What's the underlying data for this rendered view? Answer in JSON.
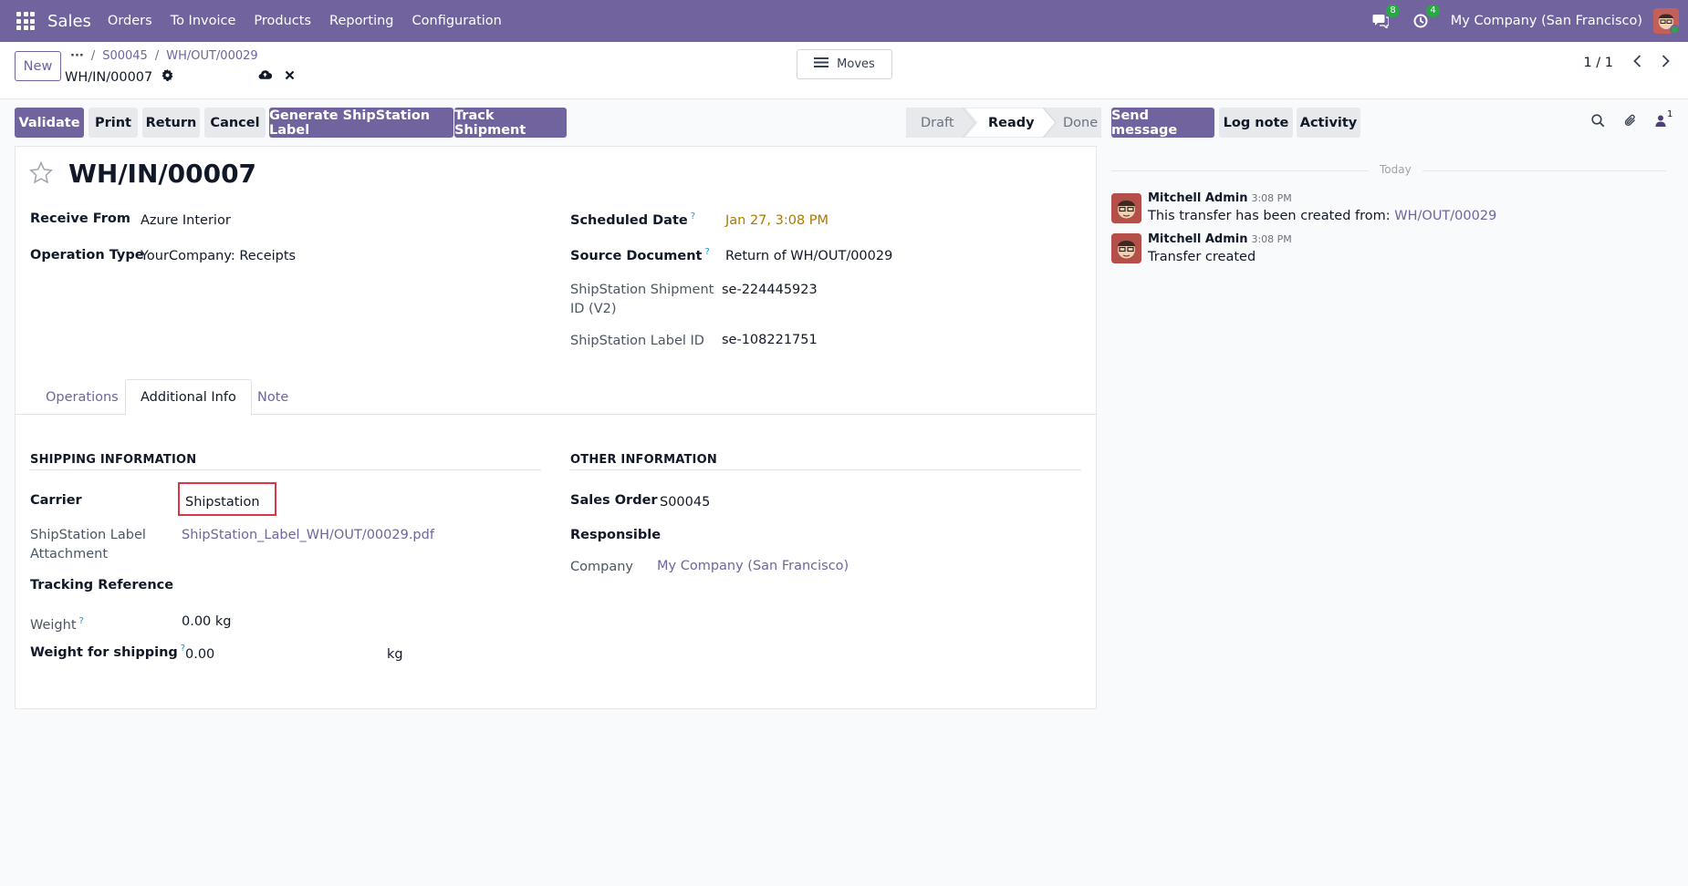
{
  "nav": {
    "app_name": "Sales",
    "menu": [
      "Orders",
      "To Invoice",
      "Products",
      "Reporting",
      "Configuration"
    ],
    "messages_count": "8",
    "activities_count": "4",
    "company": "My Company (San Francisco)"
  },
  "control": {
    "new_label": "New",
    "breadcrumbs": [
      "S00045",
      "WH/OUT/00029"
    ],
    "record_name": "WH/IN/00007",
    "moves_label": "Moves",
    "pager": "1 / 1"
  },
  "actions": {
    "validate": "Validate",
    "print": "Print",
    "return": "Return",
    "cancel": "Cancel",
    "generate_label": "Generate ShipStation Label",
    "track": "Track Shipment"
  },
  "status": {
    "draft": "Draft",
    "ready": "Ready",
    "done": "Done",
    "current": "Ready"
  },
  "form": {
    "title": "WH/IN/00007",
    "receive_from_label": "Receive From",
    "receive_from": "Azure Interior",
    "operation_type_label": "Operation Type",
    "operation_type": "YourCompany: Receipts",
    "scheduled_date_label": "Scheduled Date",
    "scheduled_date": "Jan 27, 3:08 PM",
    "source_document_label": "Source Document",
    "source_document": "Return of WH/OUT/00029",
    "shipment_id_label_1": "ShipStation Shipment",
    "shipment_id_label_2": "ID (V2)",
    "shipment_id": "se-224445923",
    "label_id_label": "ShipStation Label ID",
    "label_id": "se-108221751",
    "help_mark": "?"
  },
  "tabs": [
    "Operations",
    "Additional Info",
    "Note"
  ],
  "shipping": {
    "title": "SHIPPING INFORMATION",
    "carrier_label": "Carrier",
    "carrier": "Shipstation",
    "attachment_label_1": "ShipStation Label",
    "attachment_label_2": "Attachment",
    "attachment": "ShipStation_Label_WH/OUT/00029.pdf",
    "tracking_label": "Tracking Reference",
    "weight_label": "Weight",
    "weight": "0.00",
    "weight_unit": "kg",
    "weight_ship_label": "Weight for shipping",
    "weight_ship": "0.00",
    "weight_ship_unit": "kg"
  },
  "other": {
    "title": "OTHER INFORMATION",
    "sales_order_label": "Sales Order",
    "sales_order": "S00045",
    "responsible_label": "Responsible",
    "company_label": "Company",
    "company": "My Company (San Francisco)"
  },
  "chatter": {
    "send_message": "Send message",
    "log_note": "Log note",
    "activity": "Activity",
    "followers_count": "1",
    "today": "Today",
    "messages": [
      {
        "author": "Mitchell Admin",
        "time": "3:08 PM",
        "text": "This transfer has been created from: ",
        "link": "WH/OUT/00029"
      },
      {
        "author": "Mitchell Admin",
        "time": "3:08 PM",
        "text": "Transfer created"
      }
    ]
  },
  "colors": {
    "brand": "#71639e",
    "highlight_border": "#dc3545",
    "warning_date": "#b07700"
  }
}
